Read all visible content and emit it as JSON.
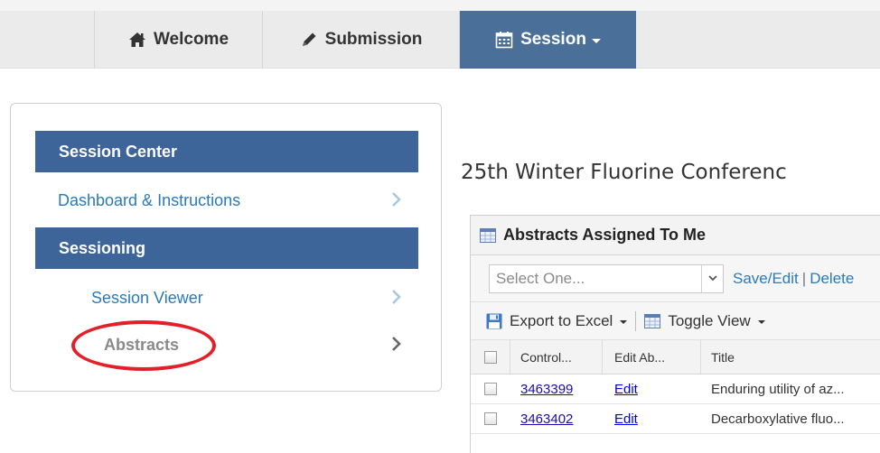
{
  "nav": {
    "tabs": [
      {
        "label": "Welcome",
        "icon": "home-icon"
      },
      {
        "label": "Submission",
        "icon": "pencil-icon"
      },
      {
        "label": "Session",
        "icon": "calendar-icon",
        "active": true,
        "has_dropdown": true
      }
    ]
  },
  "sidebar": {
    "header1": "Session Center",
    "link1": "Dashboard & Instructions",
    "header2": "Sessioning",
    "link2": "Session Viewer",
    "link3": "Abstracts"
  },
  "main": {
    "conference_title": "25th Winter Fluorine Conferenc",
    "grid": {
      "title": "Abstracts Assigned To Me",
      "select_placeholder": "Select One...",
      "save_edit": "Save/Edit",
      "separator": "|",
      "delete": "Delete",
      "export": "Export to Excel",
      "toggle_view": "Toggle View",
      "columns": [
        "Control...",
        "Edit Ab...",
        "Title"
      ],
      "rows": [
        {
          "control": "3463399",
          "edit": "Edit",
          "title": "Enduring utility of az..."
        },
        {
          "control": "3463402",
          "edit": "Edit",
          "title": "Decarboxylative fluo..."
        }
      ]
    }
  },
  "colors": {
    "active_tab": "#4a6f99",
    "sidebar_header": "#3d6599",
    "link": "#2a7ab9",
    "highlight_oval": "#e3202a"
  }
}
